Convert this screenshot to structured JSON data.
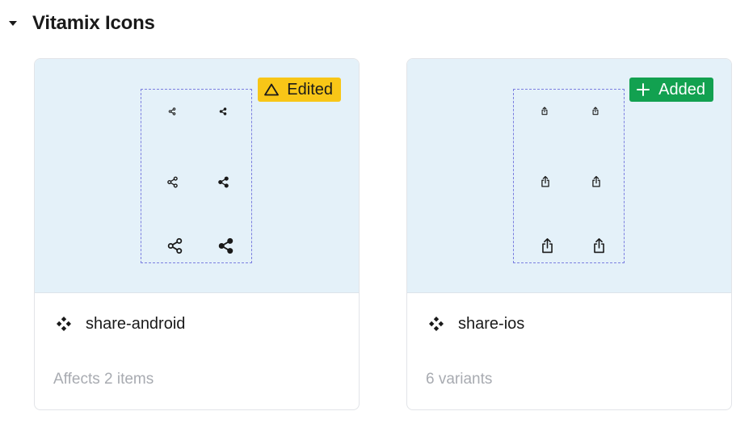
{
  "section": {
    "title": "Vitamix Icons",
    "expanded": true
  },
  "cards": [
    {
      "name": "share-android",
      "meta": "Affects 2 items",
      "badge": {
        "label": "Edited",
        "icon": "warning-triangle-icon",
        "color": "#f8c617"
      },
      "variant_icon": "share-android-icon",
      "variant_count": 6
    },
    {
      "name": "share-ios",
      "meta": "6 variants",
      "badge": {
        "label": "Added",
        "icon": "plus-icon",
        "color": "#12a150"
      },
      "variant_icon": "share-ios-icon",
      "variant_count": 6
    }
  ],
  "colors": {
    "preview_bg": "#e4f1f9",
    "frame_border": "#7b7fe0",
    "meta_text": "#a8abb1"
  }
}
